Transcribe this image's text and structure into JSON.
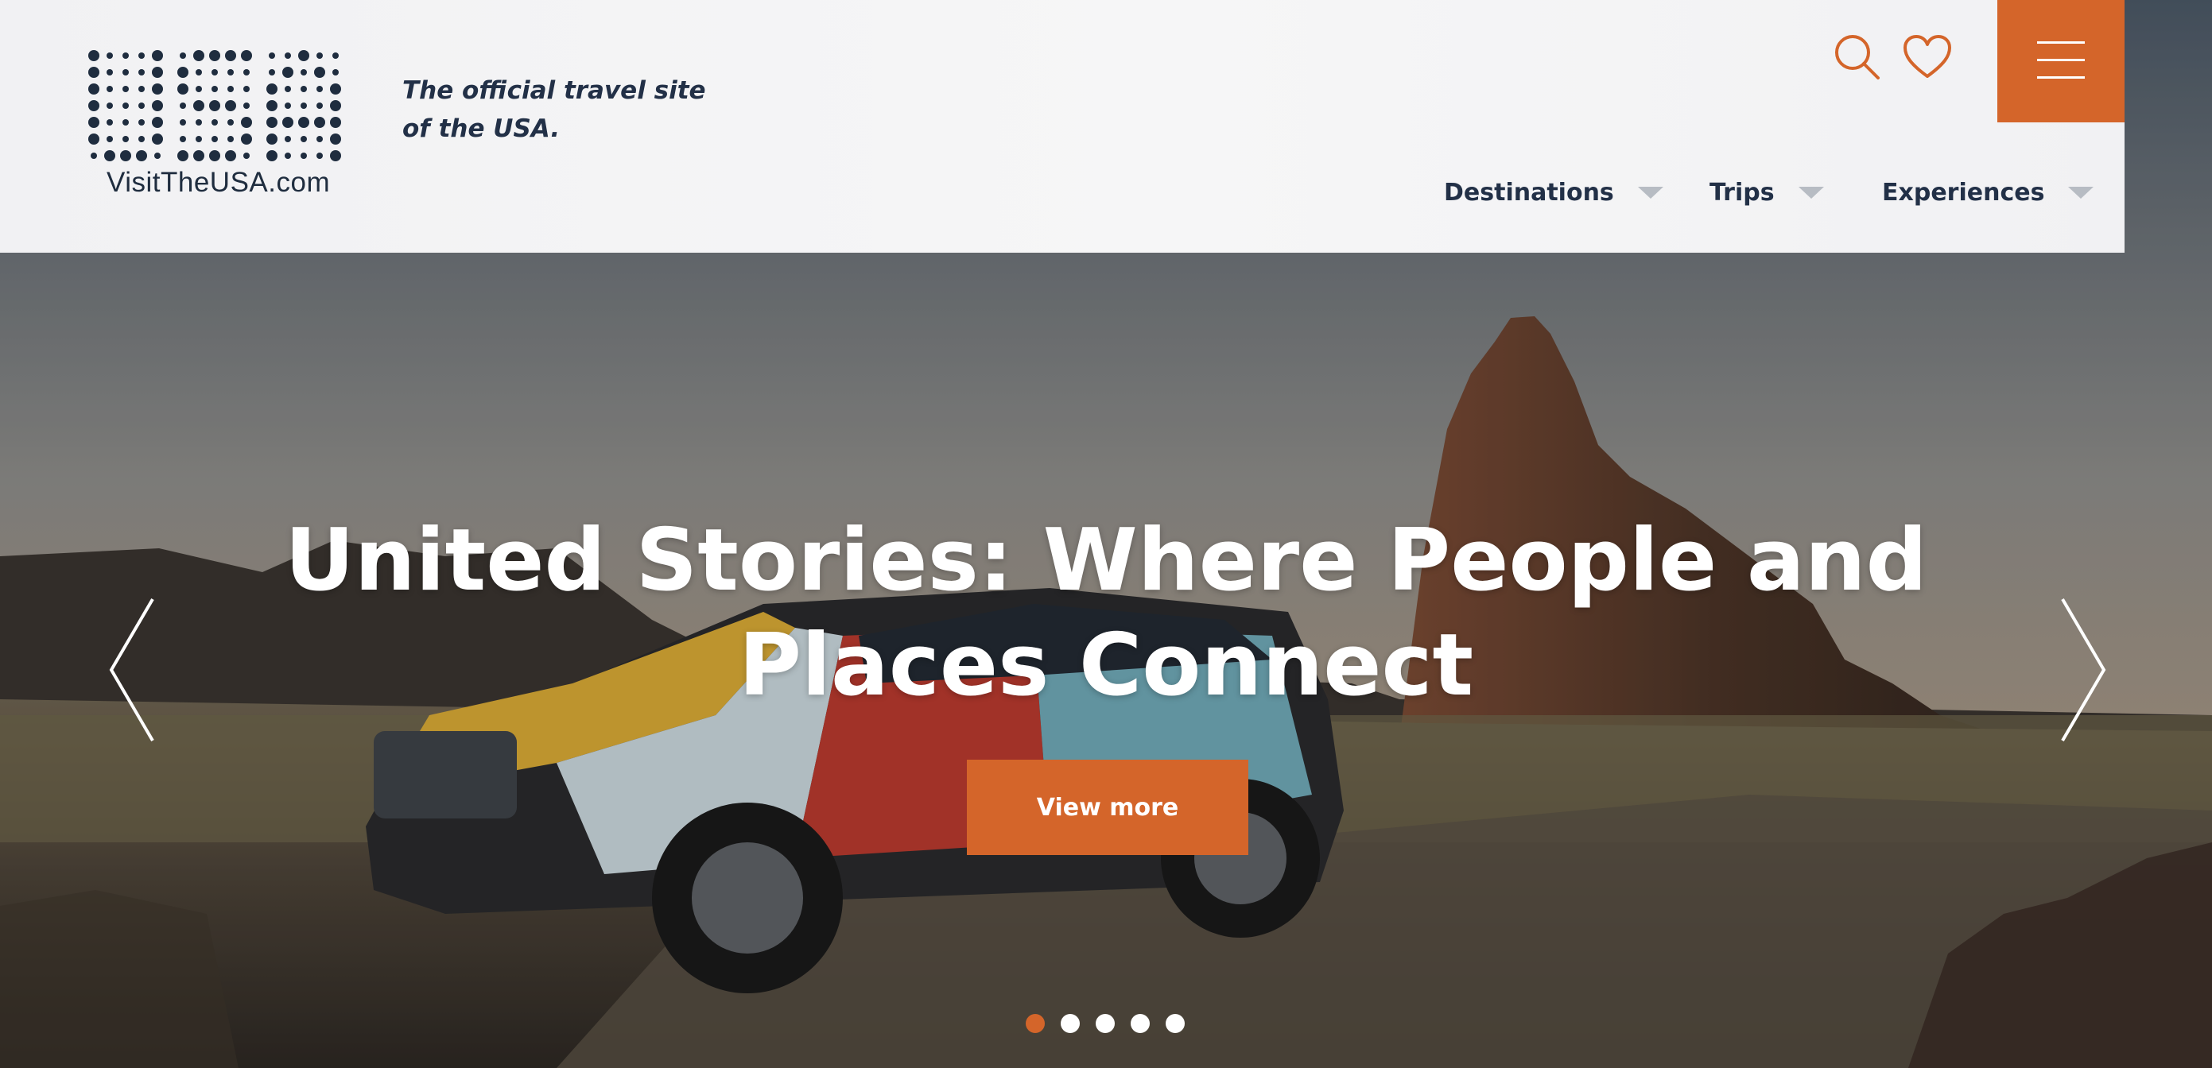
{
  "header": {
    "logo_text": "VisitTheUSA.com",
    "tagline_line1": "The official travel site",
    "tagline_line2": "of the USA.",
    "search_icon": "search-icon",
    "favorites_icon": "heart-icon",
    "menu_icon": "hamburger-menu-icon"
  },
  "nav": {
    "items": [
      {
        "label": "Destinations",
        "icon": "chevron-down-icon"
      },
      {
        "label": "Trips",
        "icon": "chevron-down-icon"
      },
      {
        "label": "Experiences",
        "icon": "chevron-down-icon"
      }
    ]
  },
  "hero": {
    "headline_line1": "United Stories: Where People and",
    "headline_line2": "Places Connect",
    "cta_label": "View more",
    "prev_icon": "chevron-left-icon",
    "next_icon": "chevron-right-icon",
    "slides_total": 5,
    "active_slide": 1
  },
  "colors": {
    "accent": "#d4652a",
    "navy": "#223047",
    "header_bg": "#f3f3f4",
    "dot_inactive": "#ffffff"
  }
}
